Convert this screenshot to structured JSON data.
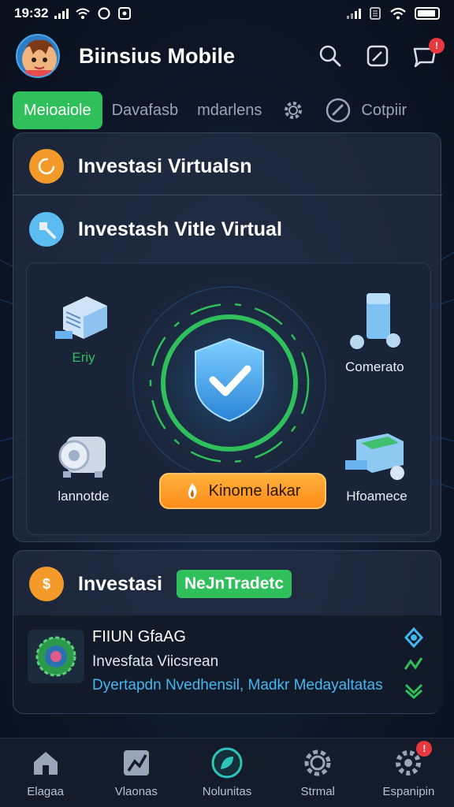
{
  "status_bar": {
    "time": "19:32",
    "colors": {
      "text": "#ffffff"
    }
  },
  "header": {
    "app_title": "Biinsius Mobile",
    "notification_count": "!",
    "icons": [
      "avatar",
      "search-icon",
      "edit-icon",
      "chat-icon"
    ]
  },
  "tabs": [
    {
      "label": "Meioaiole",
      "active": true
    },
    {
      "label": "Davafasb",
      "active": false
    },
    {
      "label": "mdarlens",
      "active": false
    },
    {
      "label": "",
      "icon": "gear-icon"
    },
    {
      "label": "Cotpiir",
      "icon": "speed-icon"
    }
  ],
  "main_card": {
    "title": "Investasi Virtualsn",
    "subtitle": "Investash Vitle Virtual",
    "nodes": [
      {
        "label": "Eriy",
        "icon": "building-icon"
      },
      {
        "label": "Comerato",
        "icon": "server-icon"
      },
      {
        "label": "lannotde",
        "icon": "engine-icon"
      },
      {
        "label": "Hfoamece",
        "icon": "printer-icon"
      }
    ],
    "cta_label": "Kinome lakar"
  },
  "invest_card": {
    "title": "Investasi",
    "badge": "NeJnTradetc",
    "fund": {
      "name": "FIIUN GfaAG",
      "subtitle": "Invesfata Viicsrean",
      "description": "Dyertapdn Nvedhensil, Madkr Medayaltatas"
    }
  },
  "bottom_nav": [
    {
      "label": "Elagaa",
      "icon": "home-icon"
    },
    {
      "label": "Vlaonas",
      "icon": "chart-icon"
    },
    {
      "label": "Nolunitas",
      "icon": "leaf-icon"
    },
    {
      "label": "Strmal",
      "icon": "gear-icon"
    },
    {
      "label": "Espanipin",
      "icon": "settings-icon",
      "badge": "!"
    }
  ],
  "colors": {
    "accent_green": "#2fbf5b",
    "accent_orange": "#ff9a24",
    "accent_blue": "#41b8f0",
    "background": "#0e1729"
  }
}
